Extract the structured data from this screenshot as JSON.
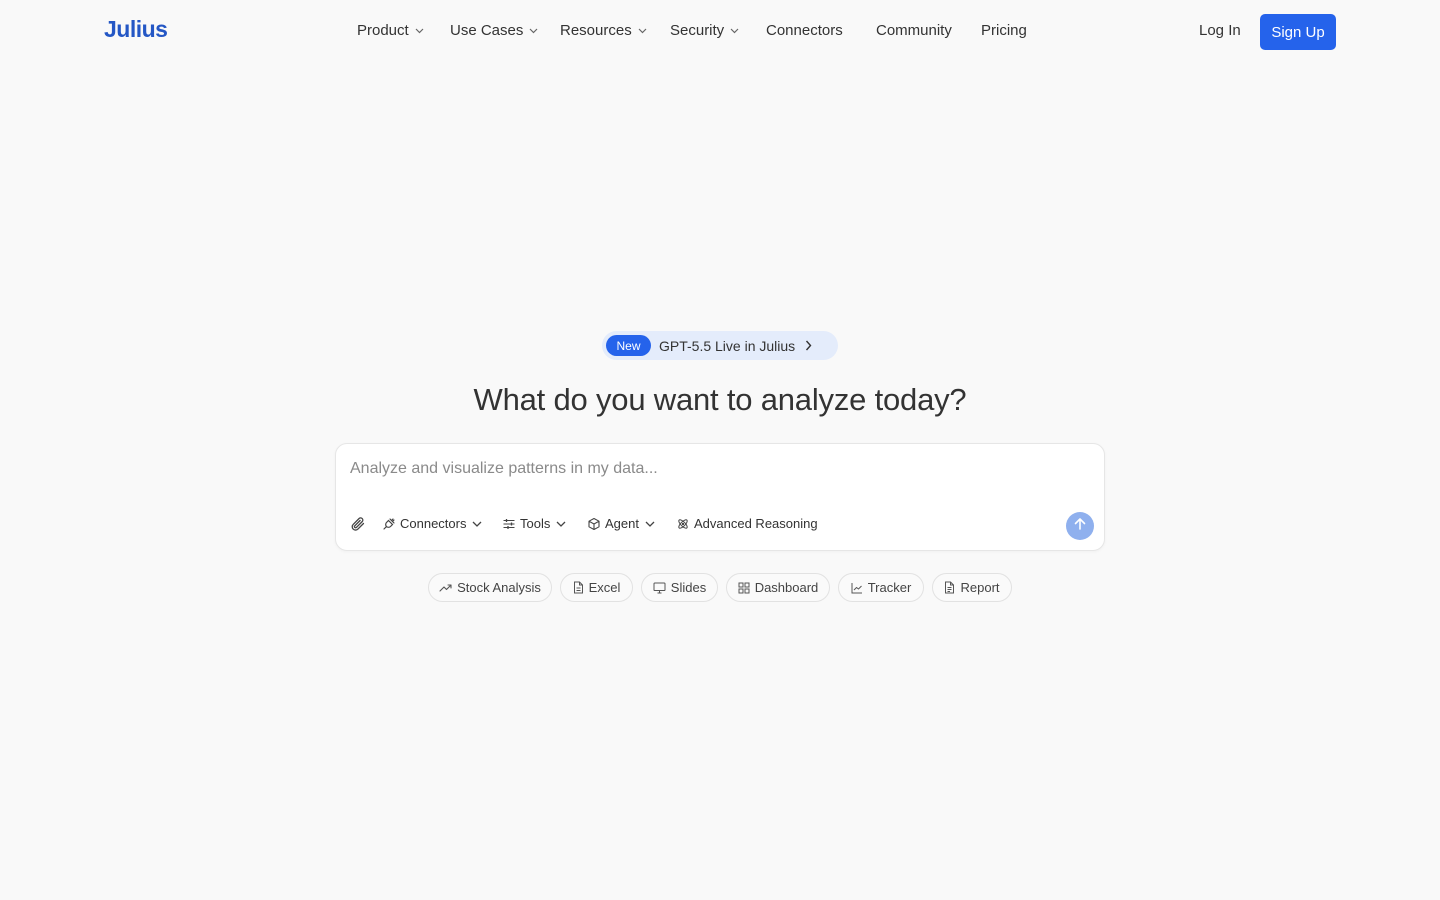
{
  "brand": {
    "logo": "Julius"
  },
  "nav": {
    "items": [
      {
        "label": "Product",
        "dropdown": true
      },
      {
        "label": "Use Cases",
        "dropdown": true
      },
      {
        "label": "Resources",
        "dropdown": true
      },
      {
        "label": "Security",
        "dropdown": true
      },
      {
        "label": "Connectors",
        "dropdown": false
      },
      {
        "label": "Community",
        "dropdown": false
      },
      {
        "label": "Pricing",
        "dropdown": false
      }
    ],
    "login_label": "Log In",
    "signup_label": "Sign Up"
  },
  "announcement": {
    "badge": "New",
    "text": "GPT-5.5 Live in Julius"
  },
  "hero": {
    "title": "What do you want to analyze today?"
  },
  "prompt": {
    "placeholder": "Analyze and visualize patterns in my data...",
    "value": "",
    "tools": [
      {
        "label": "Connectors",
        "icon": "plug-icon",
        "dropdown": true
      },
      {
        "label": "Tools",
        "icon": "sliders-icon",
        "dropdown": true
      },
      {
        "label": "Agent",
        "icon": "cube-icon",
        "dropdown": true
      },
      {
        "label": "Advanced Reasoning",
        "icon": "atom-icon",
        "dropdown": false
      }
    ]
  },
  "suggestions": [
    {
      "label": "Stock Analysis",
      "icon": "trend-up-icon"
    },
    {
      "label": "Excel",
      "icon": "file-icon"
    },
    {
      "label": "Slides",
      "icon": "presentation-icon"
    },
    {
      "label": "Dashboard",
      "icon": "grid-icon"
    },
    {
      "label": "Tracker",
      "icon": "line-chart-icon"
    },
    {
      "label": "Report",
      "icon": "document-icon"
    }
  ],
  "colors": {
    "accent": "#2563eb",
    "logo": "#2457c5",
    "background": "#f9f9f9",
    "send_button": "#8fb0ee"
  }
}
